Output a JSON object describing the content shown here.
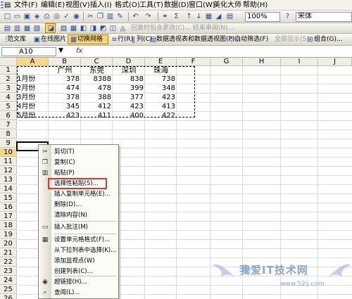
{
  "menubar": {
    "items": [
      "文件(F)",
      "编辑(E)",
      "视图(V)",
      "插入(I)",
      "格式(O)",
      "工具(T)",
      "数据(D)",
      "窗口(W)",
      "美化大师",
      "帮助(H)"
    ]
  },
  "toolbar1": {
    "zoom": "100%",
    "font": "宋体"
  },
  "toolbar2": {
    "review_text": "回复时包含更改(C)... 结束审阅(N)..."
  },
  "toolbar3": {
    "items": [
      "范文库",
      "在线图片",
      "切换网格",
      "行(R)",
      "列(C)",
      "数据透视表和数据透视图(P)...",
      "自动筛选(F)",
      "全部显示(S)",
      "组合(G)..."
    ]
  },
  "formula_bar": {
    "name_box": "A10",
    "fx": "fx"
  },
  "sheet": {
    "columns": [
      "A",
      "B",
      "C",
      "D",
      "E",
      "F",
      "G",
      "H",
      "I",
      "J"
    ],
    "rows": [
      "1",
      "2",
      "3",
      "4",
      "5",
      "6",
      "7",
      "8",
      "9",
      "10",
      "11",
      "12",
      "13",
      "14",
      "15",
      "16",
      "17",
      "18",
      "19",
      "20",
      "21",
      "22",
      "23",
      "24",
      "25",
      "26"
    ],
    "header_row": [
      "广州",
      "东莞",
      "深圳",
      "珠海"
    ],
    "data": [
      {
        "month": "1月份",
        "values": [
          "378",
          "8388",
          "838",
          "738"
        ]
      },
      {
        "month": "2月份",
        "values": [
          "474",
          "478",
          "399",
          "348"
        ]
      },
      {
        "month": "3月份",
        "values": [
          "378",
          "388",
          "377",
          "423"
        ]
      },
      {
        "month": "4月份",
        "values": [
          "345",
          "412",
          "423",
          "413"
        ]
      },
      {
        "month": "5月份",
        "values": [
          "423",
          "411",
          "400",
          "422"
        ]
      }
    ],
    "active_cell": "A10"
  },
  "context_menu": {
    "items": [
      {
        "label": "剪切(T)",
        "icon": "cut-icon"
      },
      {
        "label": "复制(C)",
        "icon": "copy-icon"
      },
      {
        "label": "粘贴(P)",
        "icon": "paste-icon"
      },
      {
        "label": "选择性粘贴(S)...",
        "icon": ""
      },
      {
        "label": "插入复制单元格(E)...",
        "icon": ""
      },
      {
        "label": "删除(D)...",
        "icon": ""
      },
      {
        "label": "清除内容(N)",
        "icon": ""
      },
      {
        "label": "插入批注(M)",
        "icon": "comment-icon"
      },
      {
        "label": "设置单元格格式(F)...",
        "icon": "format-cells-icon"
      },
      {
        "label": "从下拉列表中选择(K)...",
        "icon": ""
      },
      {
        "label": "添加监视点(W)",
        "icon": ""
      },
      {
        "label": "创建列表(C)...",
        "icon": ""
      },
      {
        "label": "超链接(H)...",
        "icon": "hyperlink-icon"
      },
      {
        "label": "查阅(L)...",
        "icon": "lookup-icon"
      }
    ],
    "highlighted": "选择性粘贴(S)..."
  },
  "watermark": {
    "main": "我爱IT技术网",
    "url": "www.52ij.com"
  }
}
